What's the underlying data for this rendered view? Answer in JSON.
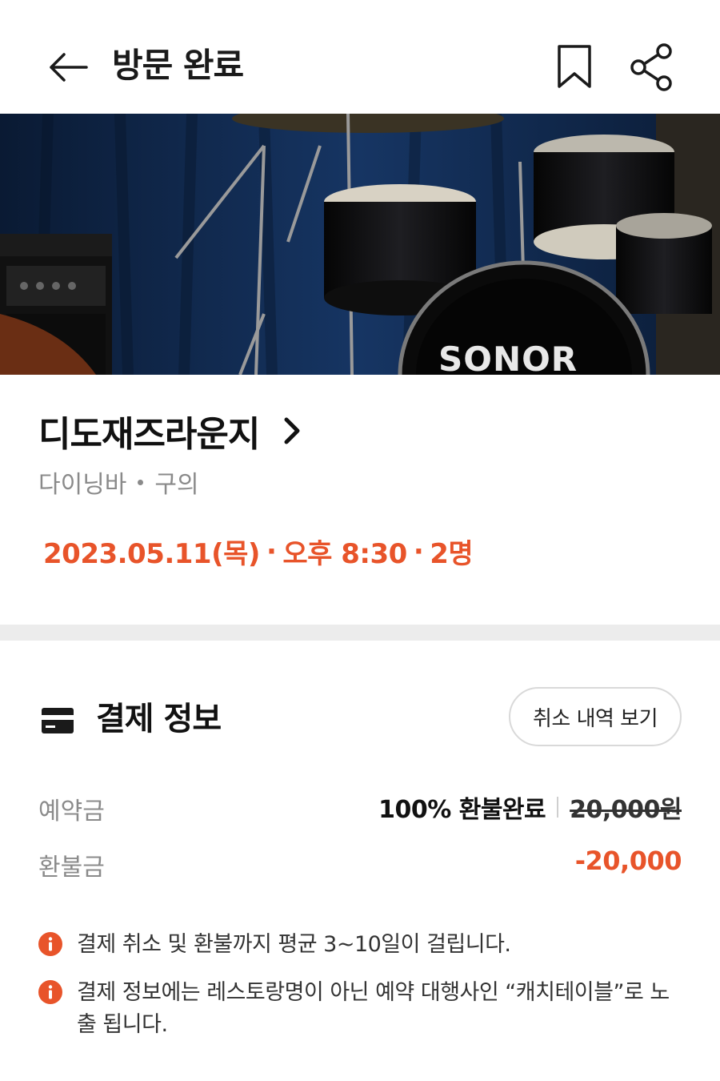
{
  "header": {
    "title": "방문 완료",
    "icons": {
      "back": "arrow-left-icon",
      "bookmark": "bookmark-icon",
      "share": "share-icon"
    }
  },
  "hero": {
    "image": "drum-kit-photo",
    "brand_text": "SONOR"
  },
  "restaurant": {
    "name": "디도재즈라운지",
    "category": "다이닝바",
    "location": "구의"
  },
  "booking": {
    "date": "2023.05.11(목)",
    "time": "오후 8:30",
    "party_size": "2명",
    "separator": "·"
  },
  "payment": {
    "title": "결제 정보",
    "cancel_history_label": "취소 내역 보기",
    "deposit_label": "예약금",
    "refund_status": "100% 환불완료",
    "original_price": "20,000원",
    "refund_label": "환불금",
    "refund_amount": "-20,000",
    "notices": [
      "결제 취소 및 환불까지 평균 3~10일이 걸립니다.",
      "결제 정보에는 레스토랑명이 아닌 예약 대행사인 “캐치테이블”로 노출 됩니다."
    ]
  },
  "colors": {
    "accent": "#e8542a",
    "muted_text": "#8a8a8a",
    "divider": "#ececec"
  }
}
